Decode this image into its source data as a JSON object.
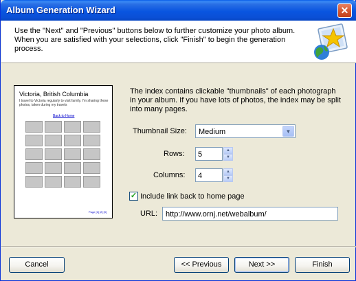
{
  "window": {
    "title": "Album Generation Wizard",
    "close_glyph": "✕"
  },
  "header": {
    "text": "Use the \"Next\" and \"Previous\" buttons below to further customize your photo album. When you are satisfied with your selections, click \"Finish\" to begin the generation process.",
    "icon": "album-star-globe-icon"
  },
  "preview": {
    "title": "Victoria, British Columbia",
    "desc": "I travel to Victoria regularly to visit family. I'm sharing these photos, taken during my travels",
    "link": "Back to Home",
    "pages": "Page [1] [2] [3]",
    "thumb_count": 20
  },
  "description": "The index contains clickable \"thumbnails\" of each photograph in your album. If you have lots of photos, the index may be split into many pages.",
  "form": {
    "thumb_size_label": "Thumbnail Size:",
    "thumb_size_value": "Medium",
    "rows_label": "Rows:",
    "rows_value": "5",
    "columns_label": "Columns:",
    "columns_value": "4",
    "include_link_label": "Include link back to home page",
    "include_link_checked": true,
    "url_label": "URL:",
    "url_value": "http://www.ornj.net/webalbum/"
  },
  "buttons": {
    "cancel": "Cancel",
    "previous": "<< Previous",
    "next": "Next >>",
    "finish": "Finish"
  }
}
